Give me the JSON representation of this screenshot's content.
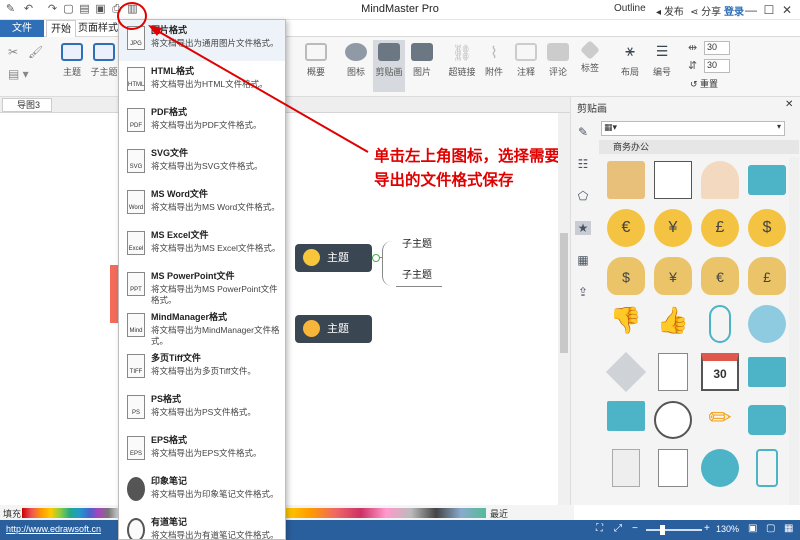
{
  "app": {
    "title": "MindMaster Pro"
  },
  "titlebar": {
    "outline": "Outline",
    "publish": "发布",
    "share": "分享",
    "login": "登录"
  },
  "tabs": {
    "file": "文件",
    "start": "开始",
    "page_style": "页面样式"
  },
  "ribbon": {
    "theme": "主题",
    "subtopic": "子主题",
    "summary": "概要",
    "icon": "图标",
    "clipart": "剪贴画",
    "image": "图片",
    "hyperlink": "超链接",
    "attachment": "附件",
    "note": "注释",
    "comment": "评论",
    "tag": "标签",
    "layout": "布局",
    "numbering": "编号",
    "spacing1": "30",
    "spacing2": "30",
    "reset": "重置"
  },
  "doc": {
    "tab": "导图3"
  },
  "canvas": {
    "topic1": "主题",
    "topic2": "主题",
    "sub1": "子主题",
    "sub2": "子主题"
  },
  "annotation": "单击左上角图标，选择需要导出的文件格式保存",
  "sidebar": {
    "title": "剪贴画",
    "category": "商务办公",
    "calendar_day": "30"
  },
  "status": {
    "fill": "填充",
    "recent": "最近",
    "url": "http://www.edrawsoft.cn",
    "zoom": "130%"
  },
  "menu": {
    "items": [
      {
        "title": "图片格式",
        "desc": "将文档导出为通用图片文件格式。",
        "icon": "JPG"
      },
      {
        "title": "HTML格式",
        "desc": "将文档导出为HTML文件格式。",
        "icon": "HTML"
      },
      {
        "title": "PDF格式",
        "desc": "将文档导出为PDF文件格式。",
        "icon": "PDF"
      },
      {
        "title": "SVG文件",
        "desc": "将文档导出为SVG文件格式。",
        "icon": "SVG"
      },
      {
        "title": "MS Word文件",
        "desc": "将文档导出为MS Word文件格式。",
        "icon": "Word"
      },
      {
        "title": "MS Excel文件",
        "desc": "将文档导出为MS Excel文件格式。",
        "icon": "Excel"
      },
      {
        "title": "MS PowerPoint文件",
        "desc": "将文档导出为MS PowerPoint文件格式。",
        "icon": "PPT"
      },
      {
        "title": "MindManager格式",
        "desc": "将文档导出为MindManager文件格式。",
        "icon": "Mind"
      },
      {
        "title": "多页Tiff文件",
        "desc": "将文档导出为多页Tiff文件。",
        "icon": "TIFF"
      },
      {
        "title": "PS格式",
        "desc": "将文档导出为PS文件格式。",
        "icon": "PS"
      },
      {
        "title": "EPS格式",
        "desc": "将文档导出为EPS文件格式。",
        "icon": "EPS"
      },
      {
        "title": "印象笔记",
        "desc": "将文档导出为印象笔记文件格式。",
        "icon": ""
      },
      {
        "title": "有道笔记",
        "desc": "将文档导出为有道笔记文件格式。",
        "icon": ""
      }
    ]
  },
  "colors": {
    "accent": "#2e6fb8",
    "annotation": "#e00000",
    "node": "#3a4652"
  }
}
